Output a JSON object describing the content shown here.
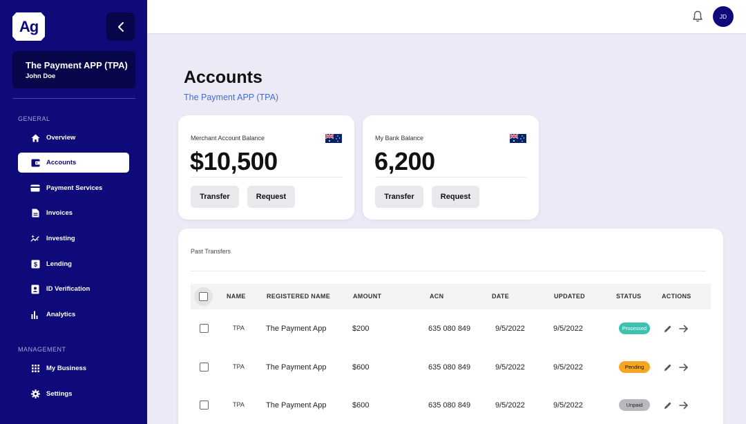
{
  "brand": {
    "logo_text": "Ag"
  },
  "account": {
    "company": "The Payment APP (TPA)",
    "user": "John Doe"
  },
  "sidebar": {
    "general_label": "GENERAL",
    "management_label": "MANAGEMENT",
    "general_items": [
      {
        "label": "Overview",
        "icon": "home-icon"
      },
      {
        "label": "Accounts",
        "icon": "wallet-icon",
        "active": true
      },
      {
        "label": "Payment Services",
        "icon": "credit-card-icon"
      },
      {
        "label": "Invoices",
        "icon": "document-icon"
      },
      {
        "label": "Investing",
        "icon": "sparkle-trend-icon"
      },
      {
        "label": "Lending",
        "icon": "dollar-icon"
      },
      {
        "label": "ID Verification",
        "icon": "id-card-icon"
      },
      {
        "label": "Analytics",
        "icon": "bar-chart-icon"
      }
    ],
    "management_items": [
      {
        "label": "My Business",
        "icon": "grid-icon"
      },
      {
        "label": "Settings",
        "icon": "gear-icon"
      }
    ]
  },
  "topbar": {
    "avatar_initials": "JD"
  },
  "page": {
    "title": "Accounts",
    "subtitle": "The Payment APP (TPA)"
  },
  "cards": [
    {
      "label": "Merchant Account Balance",
      "amount": "$10,500",
      "transfer": "Transfer",
      "request": "Request",
      "flag": "australia-flag"
    },
    {
      "label": "My Bank Balance",
      "amount": "6,200",
      "transfer": "Transfer",
      "request": "Request",
      "flag": "australia-flag"
    }
  ],
  "transfers": {
    "title": "Past Transfers",
    "columns": [
      "NAME",
      "REGISTERED NAME",
      "AMOUNT",
      "ACN",
      "DATE",
      "UPDATED",
      "STATUS",
      "ACTIONS"
    ],
    "rows": [
      {
        "name": "TPA",
        "registered_name": "The Payment App",
        "amount": "$200",
        "acn": "635 080 849",
        "date": "9/5/2022",
        "updated": "9/5/2022",
        "status": "Processed"
      },
      {
        "name": "TPA",
        "registered_name": "The Payment App",
        "amount": "$600",
        "acn": "635 080 849",
        "date": "9/5/2022",
        "updated": "9/5/2022",
        "status": "Pending"
      },
      {
        "name": "TPA",
        "registered_name": "The Payment App",
        "amount": "$600",
        "acn": "635 080 849",
        "date": "9/5/2022",
        "updated": "9/5/2022",
        "status": "Unpaid"
      }
    ]
  },
  "colors": {
    "sidebar_bg": "#0e0a7a",
    "status_processed": "#3fc1b0",
    "status_pending": "#f5a623",
    "status_unpaid": "#b9b9bd",
    "link_blue": "#3b6fd8"
  }
}
